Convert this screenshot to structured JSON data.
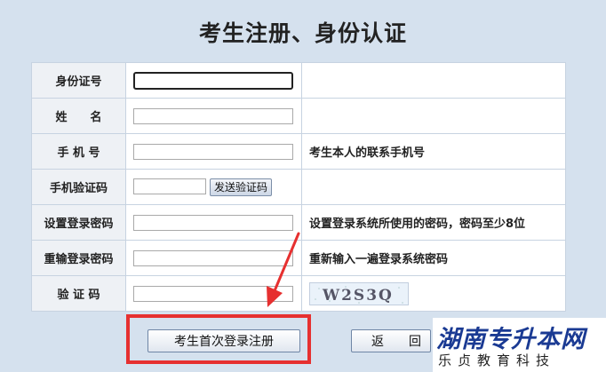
{
  "page": {
    "title": "考生注册、身份认证"
  },
  "form": {
    "rows": [
      {
        "label": "身份证号",
        "hint": ""
      },
      {
        "label": "姓　　名",
        "hint": ""
      },
      {
        "label": "手 机 号",
        "hint": "考生本人的联系手机号"
      },
      {
        "label": "手机验证码",
        "hint": ""
      },
      {
        "label": "设置登录密码",
        "hint": "设置登录系统所使用的密码，密码至少8位"
      },
      {
        "label": "重输登录密码",
        "hint": "重新输入一遍登录系统密码"
      },
      {
        "label": "验 证 码",
        "hint": ""
      }
    ],
    "send_code_label": "发送验证码",
    "captcha_text": "W2S3Q"
  },
  "buttons": {
    "register_label": "考生首次登录注册",
    "back_label": "返　　回"
  },
  "watermark": {
    "main": "湖南专升本网",
    "sub": "乐贞教育科技"
  },
  "colors": {
    "highlight_box": "#e63030",
    "logo_blue": "#1a3a93"
  }
}
